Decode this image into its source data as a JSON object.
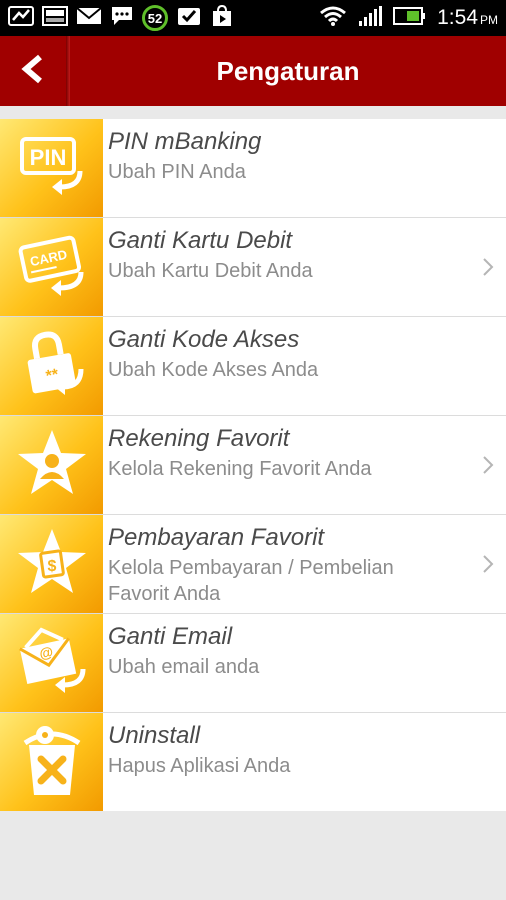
{
  "status_bar": {
    "notification_count": "52",
    "time": "1:54",
    "ampm": "PM",
    "icons": [
      "missed-call-icon",
      "photo-icon",
      "mail-icon",
      "chat-icon",
      "notification-count-icon",
      "task-check-icon",
      "store-icon",
      "wifi-icon",
      "signal-icon",
      "battery-icon"
    ]
  },
  "header": {
    "title": "Pengaturan",
    "back_icon": "back-arrow-icon",
    "color": "#a00000"
  },
  "colors": {
    "accent": "#a00000",
    "tile_yellow": "#ffc21a",
    "title_text": "#4a4a4a",
    "subtitle_text": "#8c8c8c"
  },
  "items": [
    {
      "title": "PIN mBanking",
      "subtitle": "Ubah PIN Anda",
      "icon": "pin-icon",
      "has_chevron": false
    },
    {
      "title": "Ganti Kartu Debit",
      "subtitle": "Ubah Kartu Debit Anda",
      "icon": "card-icon",
      "has_chevron": true,
      "icon_text": "CARD"
    },
    {
      "title": "Ganti Kode Akses",
      "subtitle": "Ubah Kode Akses Anda",
      "icon": "lock-icon",
      "has_chevron": false
    },
    {
      "title": "Rekening Favorit",
      "subtitle": "Kelola Rekening Favorit Anda",
      "icon": "star-user-icon",
      "has_chevron": true
    },
    {
      "title": "Pembayaran Favorit",
      "subtitle": "Kelola Pembayaran / Pembelian Favorit Anda",
      "icon": "star-dollar-icon",
      "has_chevron": true
    },
    {
      "title": "Ganti Email",
      "subtitle": "Ubah email anda",
      "icon": "email-icon",
      "has_chevron": false
    },
    {
      "title": "Uninstall",
      "subtitle": "Hapus Aplikasi Anda",
      "icon": "uninstall-icon",
      "has_chevron": false
    }
  ]
}
